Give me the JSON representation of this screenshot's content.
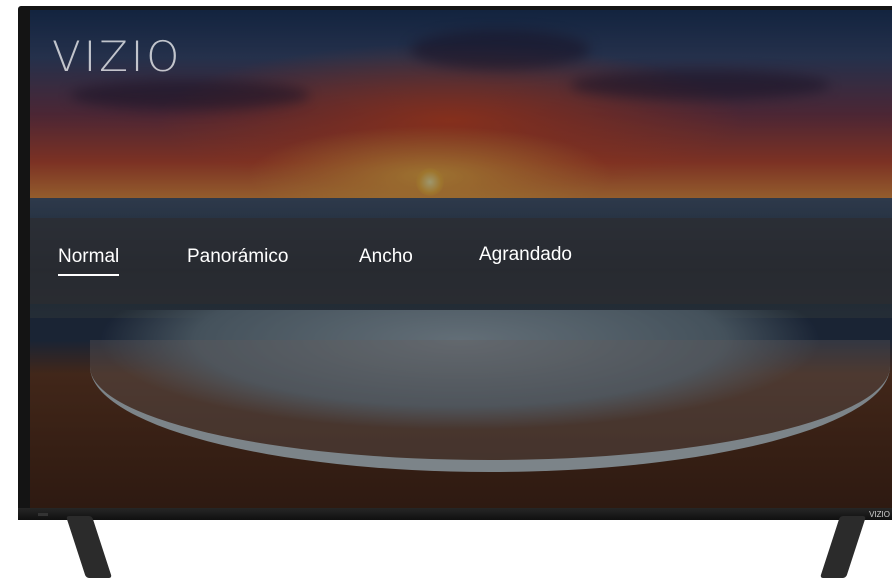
{
  "brand": {
    "logo_text": "VIZIO",
    "bezel_tag": "VIZIO"
  },
  "aspect_menu": {
    "items": [
      {
        "label": "Normal",
        "selected": true
      },
      {
        "label": "Panorámico",
        "selected": false
      },
      {
        "label": "Ancho",
        "selected": false
      },
      {
        "label": "Agrandado",
        "selected": false
      }
    ]
  },
  "colors": {
    "menu_text": "#ffffff",
    "menu_band": "#2d2d30",
    "bezel": "#141414"
  }
}
